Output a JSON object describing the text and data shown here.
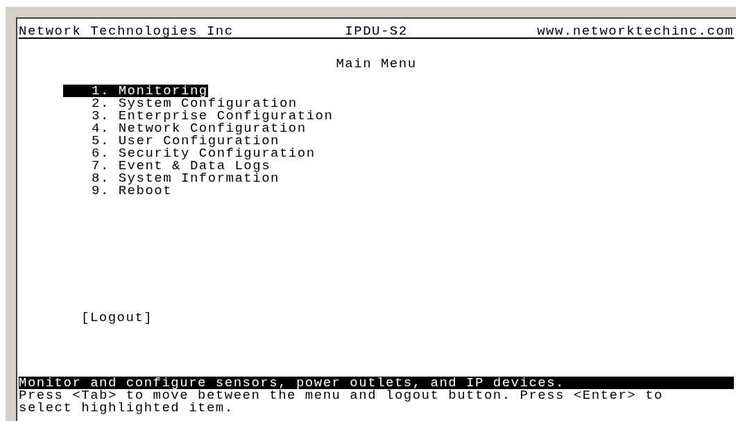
{
  "header": {
    "left": "Network Technologies Inc",
    "center": "IPDU-S2",
    "right": "www.networktechinc.com"
  },
  "title": "Main Menu",
  "menu": [
    {
      "label": "1. Monitoring",
      "selected": true
    },
    {
      "label": "2. System Configuration",
      "selected": false
    },
    {
      "label": "3. Enterprise Configuration",
      "selected": false
    },
    {
      "label": "4. Network Configuration",
      "selected": false
    },
    {
      "label": "5. User Configuration",
      "selected": false
    },
    {
      "label": "6. Security Configuration",
      "selected": false
    },
    {
      "label": "7. Event & Data Logs",
      "selected": false
    },
    {
      "label": "8. System Information",
      "selected": false
    },
    {
      "label": "9. Reboot",
      "selected": false
    }
  ],
  "logout": {
    "label": "[Logout]",
    "selected": false
  },
  "status_line": "Monitor and configure sensors, power outlets, and IP devices.",
  "help_text": "Press <Tab> to move between the menu and logout button. Press <Enter> to select highlighted item."
}
